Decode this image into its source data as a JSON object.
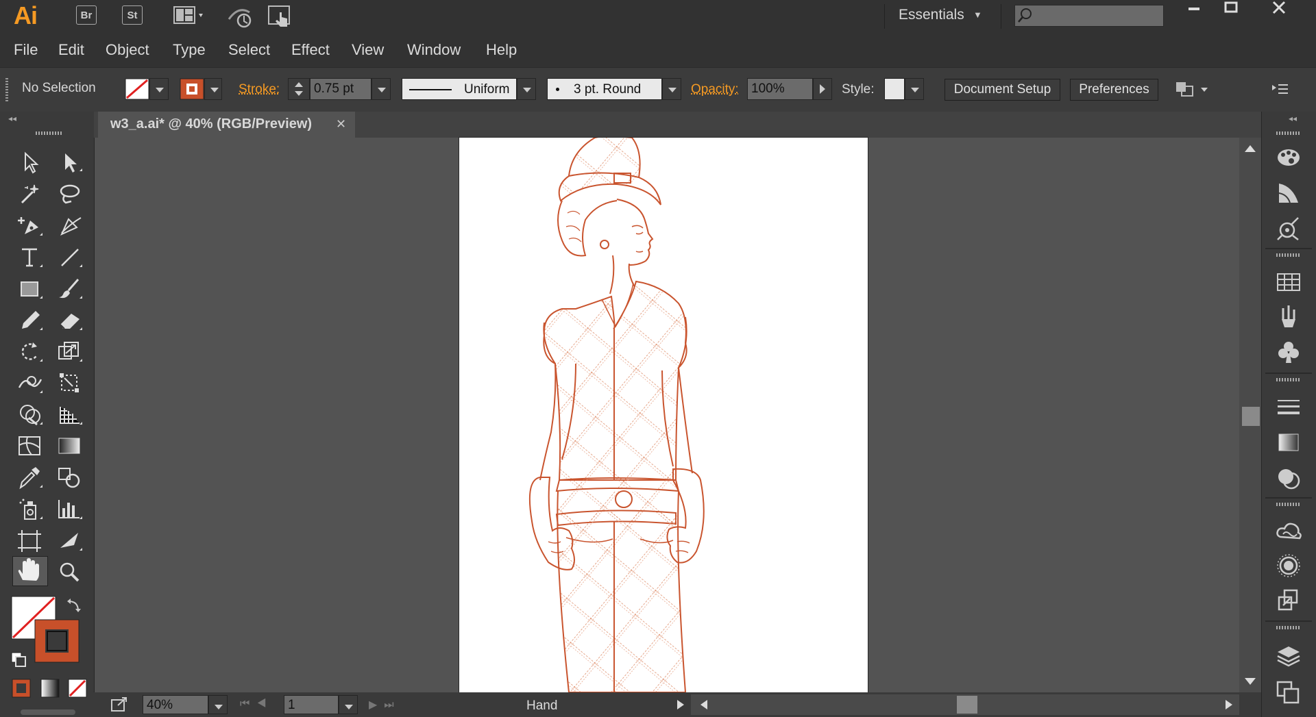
{
  "app": {
    "logo": "Ai",
    "bridge_label": "Br",
    "stock_label": "St"
  },
  "workspace": {
    "label": "Essentials"
  },
  "search": {
    "placeholder": ""
  },
  "menu": [
    "File",
    "Edit",
    "Object",
    "Type",
    "Select",
    "Effect",
    "View",
    "Window",
    "Help"
  ],
  "control": {
    "selection": "No Selection",
    "stroke_label": "Stroke:",
    "stroke_weight": "0.75 pt",
    "profile": "Uniform",
    "brush": "3 pt. Round",
    "opacity_label": "Opacity:",
    "opacity": "100%",
    "style_label": "Style:",
    "document_setup": "Document Setup",
    "preferences": "Preferences"
  },
  "document": {
    "tab_title": "w3_a.ai* @ 40% (RGB/Preview)"
  },
  "status": {
    "zoom": "40%",
    "artboard": "1",
    "tool": "Hand"
  },
  "colors": {
    "accent": "#f59a23",
    "stroke": "#c8502a",
    "artwork_line": "#c9542e"
  },
  "tools": [
    "selection-tool-icon",
    "direct-selection-tool-icon",
    "magic-wand-tool-icon",
    "lasso-tool-icon",
    "pen-tool-icon",
    "curvature-tool-icon",
    "type-tool-icon",
    "line-tool-icon",
    "rectangle-tool-icon",
    "paintbrush-tool-icon",
    "pencil-tool-icon",
    "eraser-tool-icon",
    "rotate-tool-icon",
    "scale-tool-icon",
    "warp-tool-icon",
    "free-transform-tool-icon",
    "shape-builder-tool-icon",
    "perspective-grid-tool-icon",
    "mesh-tool-icon",
    "gradient-tool-icon",
    "eyedropper-tool-icon",
    "blend-tool-icon",
    "symbol-sprayer-tool-icon",
    "graph-tool-icon",
    "artboard-tool-icon",
    "slice-tool-icon",
    "hand-tool-icon",
    "zoom-tool-icon"
  ],
  "panels": [
    "color-panel-icon",
    "color-guide-panel-icon",
    "libraries-icon",
    "swatches-panel-icon",
    "brushes-panel-icon",
    "symbols-panel-icon",
    "stroke-panel-icon",
    "gradient-panel-icon",
    "transparency-panel-icon",
    "creative-cloud-icon",
    "appearance-panel-icon",
    "export-icon",
    "layers-panel-icon",
    "artboards-panel-icon"
  ]
}
